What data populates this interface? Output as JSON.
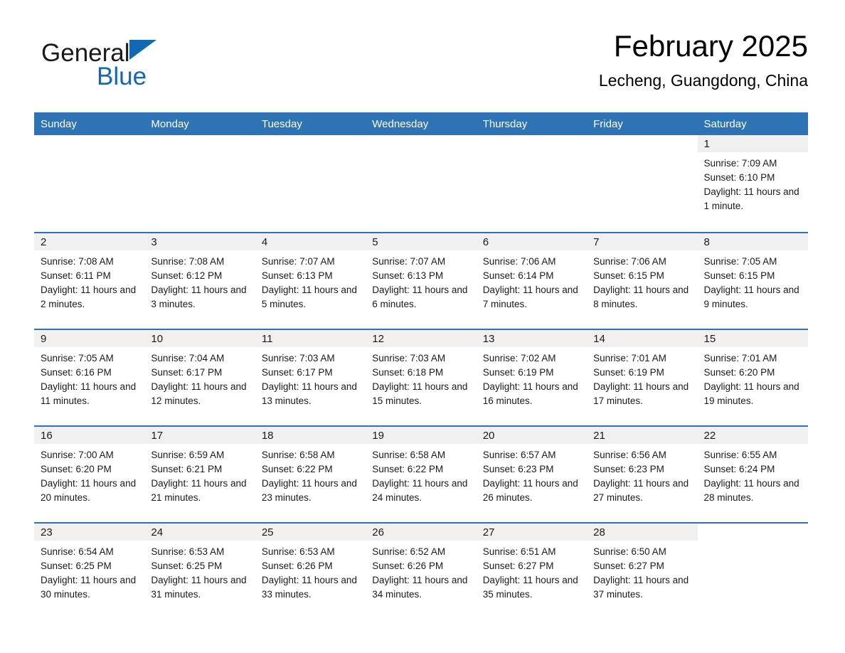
{
  "brand": {
    "name_part1": "General",
    "name_part2": "Blue",
    "logo_icon": "triangle-logo-icon",
    "accent_color": "#1268b3"
  },
  "header": {
    "month_title": "February 2025",
    "location": "Lecheng, Guangdong, China"
  },
  "colors": {
    "header_blue": "#2e74b5",
    "daynum_band": "#f0f0f0",
    "text": "#1a1a1a"
  },
  "weekday_headers": [
    "Sunday",
    "Monday",
    "Tuesday",
    "Wednesday",
    "Thursday",
    "Friday",
    "Saturday"
  ],
  "weeks": [
    [
      {
        "day": "",
        "sunrise": "",
        "sunset": "",
        "daylight": "",
        "blank": true
      },
      {
        "day": "",
        "sunrise": "",
        "sunset": "",
        "daylight": "",
        "blank": true
      },
      {
        "day": "",
        "sunrise": "",
        "sunset": "",
        "daylight": "",
        "blank": true
      },
      {
        "day": "",
        "sunrise": "",
        "sunset": "",
        "daylight": "",
        "blank": true
      },
      {
        "day": "",
        "sunrise": "",
        "sunset": "",
        "daylight": "",
        "blank": true
      },
      {
        "day": "",
        "sunrise": "",
        "sunset": "",
        "daylight": "",
        "blank": true
      },
      {
        "day": "1",
        "sunrise": "Sunrise: 7:09 AM",
        "sunset": "Sunset: 6:10 PM",
        "daylight": "Daylight: 11 hours and 1 minute.",
        "blank": false
      }
    ],
    [
      {
        "day": "2",
        "sunrise": "Sunrise: 7:08 AM",
        "sunset": "Sunset: 6:11 PM",
        "daylight": "Daylight: 11 hours and 2 minutes.",
        "blank": false
      },
      {
        "day": "3",
        "sunrise": "Sunrise: 7:08 AM",
        "sunset": "Sunset: 6:12 PM",
        "daylight": "Daylight: 11 hours and 3 minutes.",
        "blank": false
      },
      {
        "day": "4",
        "sunrise": "Sunrise: 7:07 AM",
        "sunset": "Sunset: 6:13 PM",
        "daylight": "Daylight: 11 hours and 5 minutes.",
        "blank": false
      },
      {
        "day": "5",
        "sunrise": "Sunrise: 7:07 AM",
        "sunset": "Sunset: 6:13 PM",
        "daylight": "Daylight: 11 hours and 6 minutes.",
        "blank": false
      },
      {
        "day": "6",
        "sunrise": "Sunrise: 7:06 AM",
        "sunset": "Sunset: 6:14 PM",
        "daylight": "Daylight: 11 hours and 7 minutes.",
        "blank": false
      },
      {
        "day": "7",
        "sunrise": "Sunrise: 7:06 AM",
        "sunset": "Sunset: 6:15 PM",
        "daylight": "Daylight: 11 hours and 8 minutes.",
        "blank": false
      },
      {
        "day": "8",
        "sunrise": "Sunrise: 7:05 AM",
        "sunset": "Sunset: 6:15 PM",
        "daylight": "Daylight: 11 hours and 9 minutes.",
        "blank": false
      }
    ],
    [
      {
        "day": "9",
        "sunrise": "Sunrise: 7:05 AM",
        "sunset": "Sunset: 6:16 PM",
        "daylight": "Daylight: 11 hours and 11 minutes.",
        "blank": false
      },
      {
        "day": "10",
        "sunrise": "Sunrise: 7:04 AM",
        "sunset": "Sunset: 6:17 PM",
        "daylight": "Daylight: 11 hours and 12 minutes.",
        "blank": false
      },
      {
        "day": "11",
        "sunrise": "Sunrise: 7:03 AM",
        "sunset": "Sunset: 6:17 PM",
        "daylight": "Daylight: 11 hours and 13 minutes.",
        "blank": false
      },
      {
        "day": "12",
        "sunrise": "Sunrise: 7:03 AM",
        "sunset": "Sunset: 6:18 PM",
        "daylight": "Daylight: 11 hours and 15 minutes.",
        "blank": false
      },
      {
        "day": "13",
        "sunrise": "Sunrise: 7:02 AM",
        "sunset": "Sunset: 6:19 PM",
        "daylight": "Daylight: 11 hours and 16 minutes.",
        "blank": false
      },
      {
        "day": "14",
        "sunrise": "Sunrise: 7:01 AM",
        "sunset": "Sunset: 6:19 PM",
        "daylight": "Daylight: 11 hours and 17 minutes.",
        "blank": false
      },
      {
        "day": "15",
        "sunrise": "Sunrise: 7:01 AM",
        "sunset": "Sunset: 6:20 PM",
        "daylight": "Daylight: 11 hours and 19 minutes.",
        "blank": false
      }
    ],
    [
      {
        "day": "16",
        "sunrise": "Sunrise: 7:00 AM",
        "sunset": "Sunset: 6:20 PM",
        "daylight": "Daylight: 11 hours and 20 minutes.",
        "blank": false
      },
      {
        "day": "17",
        "sunrise": "Sunrise: 6:59 AM",
        "sunset": "Sunset: 6:21 PM",
        "daylight": "Daylight: 11 hours and 21 minutes.",
        "blank": false
      },
      {
        "day": "18",
        "sunrise": "Sunrise: 6:58 AM",
        "sunset": "Sunset: 6:22 PM",
        "daylight": "Daylight: 11 hours and 23 minutes.",
        "blank": false
      },
      {
        "day": "19",
        "sunrise": "Sunrise: 6:58 AM",
        "sunset": "Sunset: 6:22 PM",
        "daylight": "Daylight: 11 hours and 24 minutes.",
        "blank": false
      },
      {
        "day": "20",
        "sunrise": "Sunrise: 6:57 AM",
        "sunset": "Sunset: 6:23 PM",
        "daylight": "Daylight: 11 hours and 26 minutes.",
        "blank": false
      },
      {
        "day": "21",
        "sunrise": "Sunrise: 6:56 AM",
        "sunset": "Sunset: 6:23 PM",
        "daylight": "Daylight: 11 hours and 27 minutes.",
        "blank": false
      },
      {
        "day": "22",
        "sunrise": "Sunrise: 6:55 AM",
        "sunset": "Sunset: 6:24 PM",
        "daylight": "Daylight: 11 hours and 28 minutes.",
        "blank": false
      }
    ],
    [
      {
        "day": "23",
        "sunrise": "Sunrise: 6:54 AM",
        "sunset": "Sunset: 6:25 PM",
        "daylight": "Daylight: 11 hours and 30 minutes.",
        "blank": false
      },
      {
        "day": "24",
        "sunrise": "Sunrise: 6:53 AM",
        "sunset": "Sunset: 6:25 PM",
        "daylight": "Daylight: 11 hours and 31 minutes.",
        "blank": false
      },
      {
        "day": "25",
        "sunrise": "Sunrise: 6:53 AM",
        "sunset": "Sunset: 6:26 PM",
        "daylight": "Daylight: 11 hours and 33 minutes.",
        "blank": false
      },
      {
        "day": "26",
        "sunrise": "Sunrise: 6:52 AM",
        "sunset": "Sunset: 6:26 PM",
        "daylight": "Daylight: 11 hours and 34 minutes.",
        "blank": false
      },
      {
        "day": "27",
        "sunrise": "Sunrise: 6:51 AM",
        "sunset": "Sunset: 6:27 PM",
        "daylight": "Daylight: 11 hours and 35 minutes.",
        "blank": false
      },
      {
        "day": "28",
        "sunrise": "Sunrise: 6:50 AM",
        "sunset": "Sunset: 6:27 PM",
        "daylight": "Daylight: 11 hours and 37 minutes.",
        "blank": false
      },
      {
        "day": "",
        "sunrise": "",
        "sunset": "",
        "daylight": "",
        "blank": true
      }
    ]
  ]
}
